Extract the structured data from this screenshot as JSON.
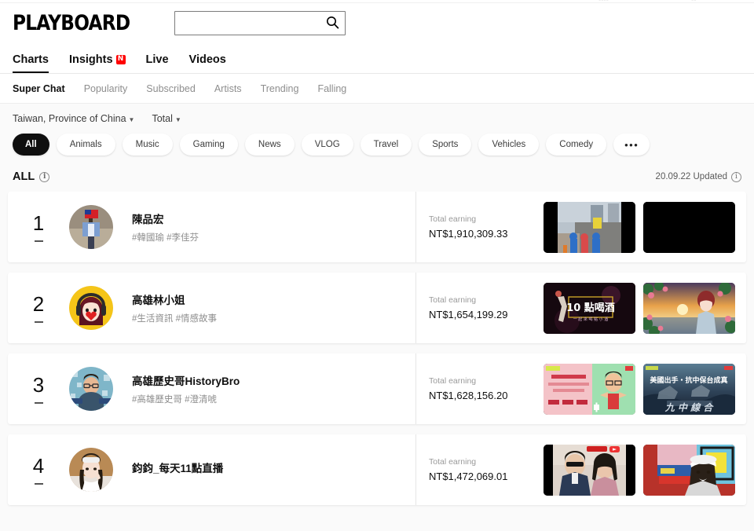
{
  "brand": {
    "logo": "PLAYBOARD"
  },
  "search": {
    "value": "",
    "placeholder": "",
    "icon": "search-icon"
  },
  "nav_primary": [
    {
      "label": "Charts",
      "active": true,
      "badge": ""
    },
    {
      "label": "Insights",
      "active": false,
      "badge": "N"
    },
    {
      "label": "Live",
      "active": false,
      "badge": ""
    },
    {
      "label": "Videos",
      "active": false,
      "badge": ""
    }
  ],
  "nav_secondary": [
    {
      "label": "Super Chat",
      "active": true
    },
    {
      "label": "Popularity",
      "active": false
    },
    {
      "label": "Subscribed",
      "active": false
    },
    {
      "label": "Artists",
      "active": false
    },
    {
      "label": "Trending",
      "active": false
    },
    {
      "label": "Falling",
      "active": false
    }
  ],
  "filters": {
    "region": "Taiwan, Province of China",
    "metric": "Total",
    "chips": [
      {
        "label": "All",
        "active": true
      },
      {
        "label": "Animals",
        "active": false
      },
      {
        "label": "Music",
        "active": false
      },
      {
        "label": "Gaming",
        "active": false
      },
      {
        "label": "News",
        "active": false
      },
      {
        "label": "VLOG",
        "active": false
      },
      {
        "label": "Travel",
        "active": false
      },
      {
        "label": "Sports",
        "active": false
      },
      {
        "label": "Vehicles",
        "active": false
      },
      {
        "label": "Comedy",
        "active": false
      },
      {
        "label": "•••",
        "active": false,
        "more": true
      }
    ]
  },
  "list_header": {
    "title": "ALL",
    "info_icon": "info-icon",
    "updated": "20.09.22 Updated"
  },
  "rows": [
    {
      "rank": "1",
      "delta": "—",
      "name": "陳品宏",
      "tags": "#韓國瑜 #李佳芬",
      "earn_label": "Total earning",
      "earn_value": "NT$1,910,309.33"
    },
    {
      "rank": "2",
      "delta": "—",
      "name": "高雄林小姐",
      "tags": "#生活資訊 #情感故事",
      "earn_label": "Total earning",
      "earn_value": "NT$1,654,199.29"
    },
    {
      "rank": "3",
      "delta": "—",
      "name": "高雄歷史哥HistoryBro",
      "tags": "#高雄歷史哥 #澄清唬",
      "earn_label": "Total earning",
      "earn_value": "NT$1,628,156.20"
    },
    {
      "rank": "4",
      "delta": "—",
      "name": "鈞鈞_每天11點直播",
      "tags": "",
      "earn_label": "Total earning",
      "earn_value": "NT$1,472,069.01"
    }
  ],
  "colors": {
    "accent_red": "#ff0000",
    "page_bg": "#fafafa",
    "card_bg": "#ffffff",
    "text_primary": "#0f0f0f",
    "text_muted": "#8c8c8c"
  }
}
